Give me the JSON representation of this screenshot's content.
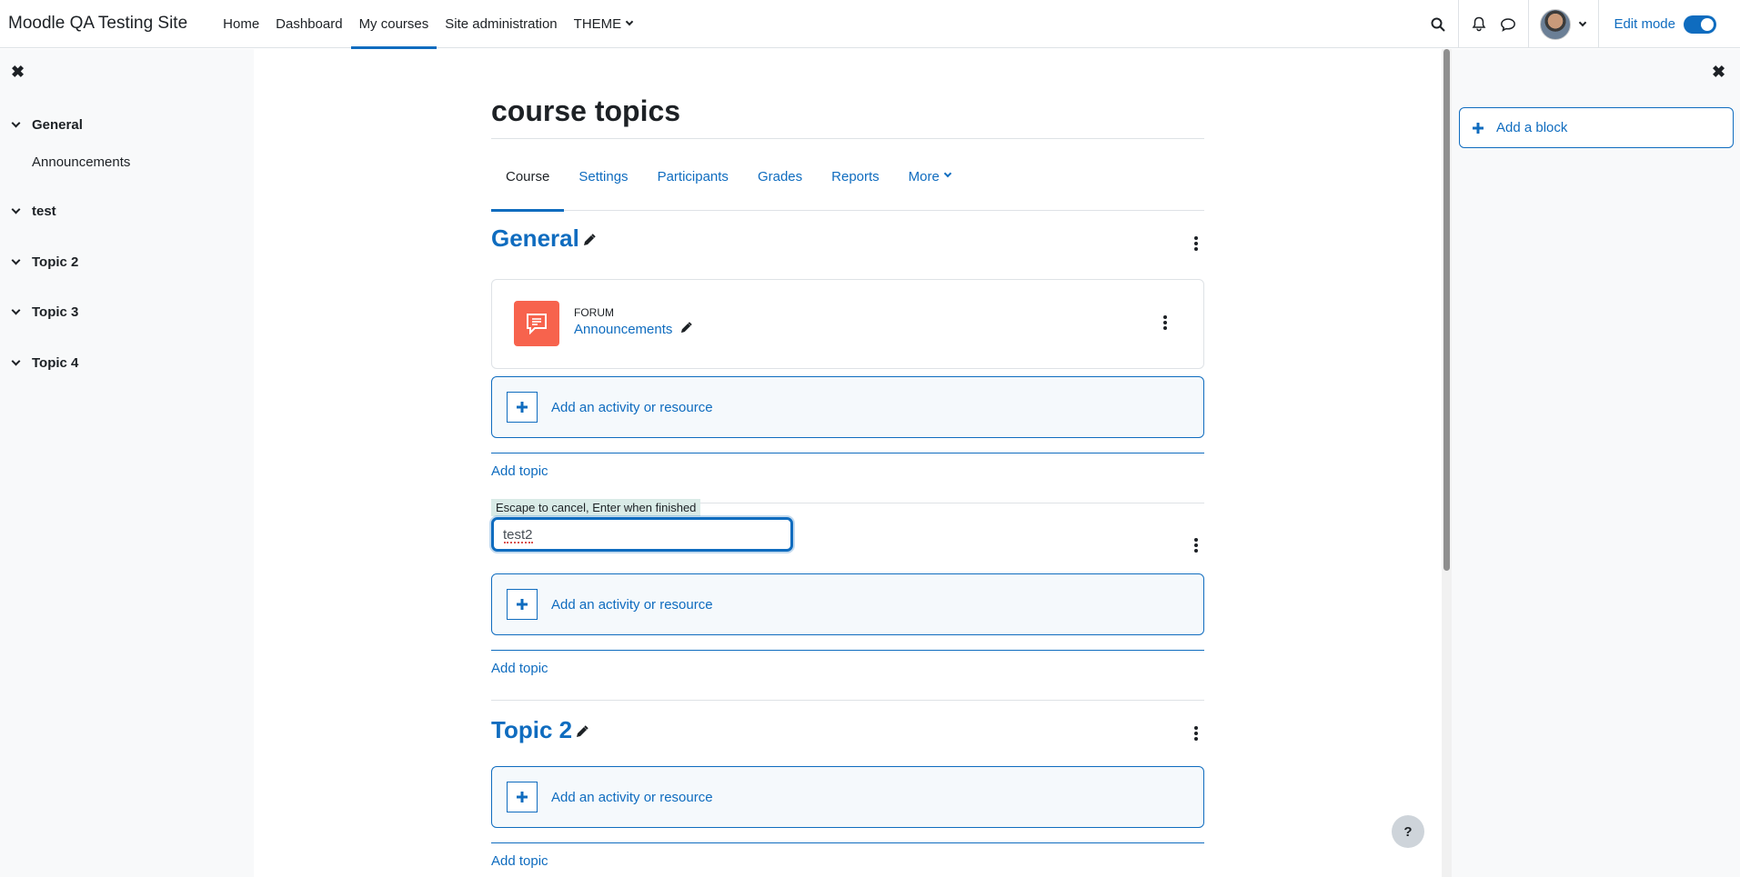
{
  "navbar": {
    "brand": "Moodle QA Testing Site",
    "links": [
      "Home",
      "Dashboard",
      "My courses",
      "Site administration",
      "THEME"
    ],
    "active_link": "My courses",
    "edit_mode_label": "Edit mode",
    "edit_mode_on": true
  },
  "course_index": {
    "sections": [
      {
        "label": "General",
        "items": [
          "Announcements"
        ]
      },
      {
        "label": "test",
        "items": []
      },
      {
        "label": "Topic 2",
        "items": []
      },
      {
        "label": "Topic 3",
        "items": []
      },
      {
        "label": "Topic 4",
        "items": []
      }
    ]
  },
  "page": {
    "title": "course topics",
    "tabs": [
      "Course",
      "Settings",
      "Participants",
      "Grades",
      "Reports",
      "More"
    ],
    "active_tab": "Course"
  },
  "sections": {
    "general_title": "General",
    "topic2_title": "Topic 2",
    "add_activity_label": "Add an activity or resource",
    "add_topic_label": "Add topic"
  },
  "activity": {
    "type": "FORUM",
    "name": "Announcements"
  },
  "inplace_edit": {
    "hint": "Escape to cancel, Enter when finished",
    "value": "test2"
  },
  "right_drawer": {
    "add_block_label": "Add a block"
  },
  "help_label": "?",
  "colors": {
    "accent": "#0f6cbf",
    "forum": "#f7634d",
    "drawer_bg": "#f8f9fa"
  }
}
